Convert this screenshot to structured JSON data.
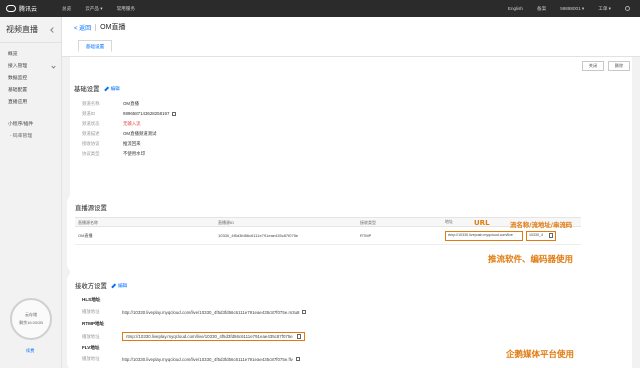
{
  "topbar": {
    "brand": "腾讯云",
    "nav": [
      "总览",
      "云产品 ▾",
      "常用服务"
    ],
    "right": [
      "English",
      "备案",
      "59888001 ▾",
      "工单 ▾"
    ]
  },
  "sidebar": {
    "title": "视频直播",
    "items": [
      {
        "label": "概览"
      },
      {
        "label": "接入管理",
        "arrow": true
      },
      {
        "label": "数据监控"
      },
      {
        "label": "基础配置"
      },
      {
        "label": "直播应用"
      },
      {
        "label": "小程序/插件"
      },
      {
        "label": "- 码率管理"
      }
    ],
    "storage": {
      "line1": "云存储",
      "line2": "剩余16.00GB"
    },
    "renew": "续费"
  },
  "header": {
    "back": "< 返回",
    "title": "OM直播",
    "tab": "基础设置"
  },
  "panel": {
    "buttons": [
      "关闭",
      "删除"
    ],
    "basic": {
      "title": "基础设置",
      "edit": "编辑",
      "rows": [
        {
          "key": "频道名称",
          "value": "OM直播"
        },
        {
          "key": "频道ID",
          "value": "9896587143628258197",
          "copy": true
        },
        {
          "key": "频道状态",
          "value": "无输入流",
          "warn": true
        },
        {
          "key": "频道描述",
          "value": "OM直播频道测试"
        },
        {
          "key": "接收协议",
          "value": "推流回来"
        },
        {
          "key": "协议类型",
          "value": "不使用水印"
        }
      ]
    }
  },
  "source": {
    "title": "直播源设置",
    "columns": [
      "直播源名称",
      "直播源ID",
      "接收类型",
      "地址"
    ],
    "row": {
      "name": "OM直播",
      "id": "10330_4f5d3fd56c6111e791eae435c87f075e",
      "type": "RTMP",
      "url": "rtmp://10330.livepush.myqcloud.com/live",
      "key": "10330_4"
    },
    "anno_url": "URL",
    "anno_key": "流名称/流地址/串流码",
    "anno_use": "推流软件、编码器使用"
  },
  "receive": {
    "title": "接收方设置",
    "edit": "编辑",
    "hls": {
      "title": "HLS地址",
      "key": "播放地址",
      "value": "http://10330.liveplay.myqcloud.com/live/10330_4f5d3fd56c6111e791eae435c87f075e.m3u8"
    },
    "rtmp": {
      "title": "RTMP地址",
      "key": "播放地址",
      "value": "rtmp://10330.liveplay.myqcloud.com/live/10330_4f5d3fd56c6111e791eae435c87f075e"
    },
    "flv": {
      "title": "FLV地址",
      "key": "播放地址",
      "value": "http://10330.liveplay.myqcloud.com/live/10330_4f5d3fd56c6111e791eae435c87f075e.flv"
    },
    "anno": "企鹅媒体平台使用"
  }
}
